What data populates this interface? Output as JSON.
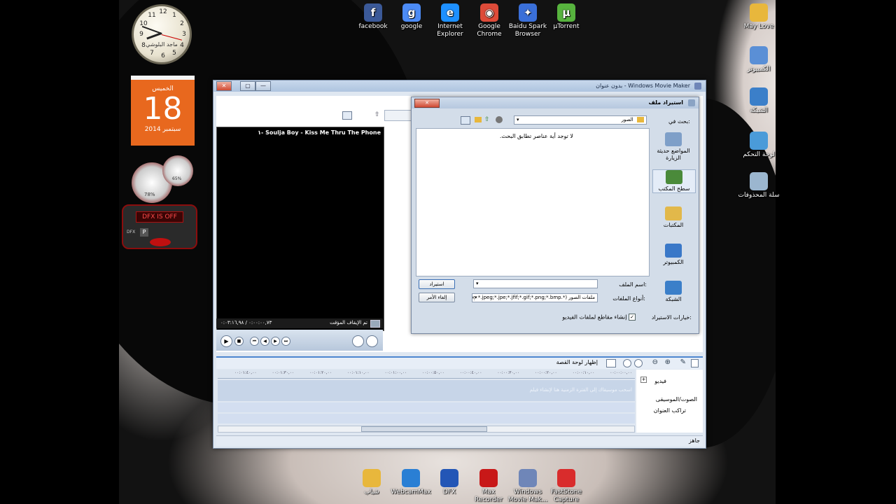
{
  "desktop": {
    "top_icons": [
      {
        "label": "facebook",
        "icon": "facebook-icon",
        "color": "#3b5998",
        "glyph": "f"
      },
      {
        "label": "google",
        "icon": "google-icon",
        "color": "#4c8bf5",
        "glyph": "g"
      },
      {
        "label": "Internet Explorer",
        "icon": "internet-explorer-icon",
        "color": "#1e90ff",
        "glyph": "e"
      },
      {
        "label": "Google Chrome",
        "icon": "chrome-icon",
        "color": "#dd4b39",
        "glyph": "◉"
      },
      {
        "label": "Baidu Spark Browser",
        "icon": "baidu-spark-icon",
        "color": "#3a6fd8",
        "glyph": "✦"
      },
      {
        "label": "µTorrent",
        "icon": "utorrent-icon",
        "color": "#57b33e",
        "glyph": "µ"
      }
    ],
    "right_icons": [
      {
        "label": "May Love ",
        "icon": "folder-icon",
        "color": "#e8b73c"
      },
      {
        "label": "الكمبيوتر",
        "icon": "computer-icon",
        "color": "#5a8fd6"
      },
      {
        "label": "الشبكة",
        "icon": "network-icon",
        "color": "#3b7fc9"
      },
      {
        "label": "لوحة التحكم",
        "icon": "control-panel-icon",
        "color": "#4a9bd9"
      },
      {
        "label": "سلة المحذوفات",
        "icon": "recycle-bin-icon",
        "color": "#9bb6cf"
      }
    ],
    "bottom_icons": [
      {
        "label": "شباب",
        "icon": "folder-icon",
        "color": "#e8b73c"
      },
      {
        "label": "WebcamMax",
        "icon": "webcammax-icon",
        "color": "#2a7fd4"
      },
      {
        "label": "DFX",
        "icon": "dfx-icon",
        "color": "#2356b6"
      },
      {
        "label": "Max Recorder",
        "icon": "max-recorder-icon",
        "color": "#c81818"
      },
      {
        "label": "Windows Movie Mak...",
        "icon": "movie-maker-icon",
        "color": "#6f86b8"
      },
      {
        "label": "FastStone Capture",
        "icon": "faststone-capture-icon",
        "color": "#d92c2c"
      }
    ]
  },
  "gadgets": {
    "clock_name": "ماجد البلوشي",
    "calendar": {
      "weekday": "الخميس",
      "day": "18",
      "month_year": "سبتمبر 2014"
    },
    "cpu_percent": "78%",
    "mem_percent": "65%",
    "dfx": {
      "status": "DFX IS OFF",
      "p_label": "P",
      "dfx_label": "DFX"
    }
  },
  "moviemaker": {
    "title": "بدون عنوان - Windows Movie Maker",
    "track_title": "١- Soulja Boy - Kiss  Me Thru The Phone",
    "player_status": "تم الإيقاف المؤقت",
    "player_time": "٠:٠٠:٠٠,٧٣ / ٠:٠٣:١٦,٩٨",
    "storyboard_toggle": "إظهار لوحة القصة",
    "timeline_hint": "اسحب موسيقاك إلى الفترة الزمنية هنا لإنشاء فيلم",
    "track_video": "فيديو",
    "track_audio": "الصوت/الموسيقى",
    "track_title_overlay": "تراكب العنوان",
    "status": "جاهز",
    "ruler": [
      "٠٠:٠٠:٠٠,٠٠",
      "٠٠:٠٠:١٠,٠٠",
      "٠٠:٠٠:٢٠,٠٠",
      "٠٠:٠٠:٣٠,٠٠",
      "٠٠:٠٠:٤٠,٠٠",
      "٠٠:٠٠:٥٠,٠٠",
      "٠٠:٠١:٠٠,٠٠",
      "٠٠:٠١:١٠,٠٠",
      "٠٠:٠١:٢٠,٠٠",
      "٠٠:٠١:٣٠,٠٠",
      "٠٠:٠١:٤٠,٠٠"
    ]
  },
  "dialog": {
    "title": "استيراد ملف",
    "look_in_label": "بحث في:",
    "look_in_value": "الصور",
    "empty_message": "لا توجد أية عناصر تطابق البحث.",
    "places": [
      "المواضع حديثة الزيارة",
      "سطح المكتب",
      "المكتبات",
      "الكمبيوتر",
      "الشبكة"
    ],
    "filename_label": "اسم الملف:",
    "filename_value": "",
    "filetype_label": "أنواع الملفات:",
    "filetype_value": "ملفات الصور (*.jpg;*.jpeg;*.jpe;*.jfif;*.gif;*.png;*.bmp)",
    "import_button": "استيراد",
    "cancel_button": "إلغاء الأمر",
    "options_label": "خيارات الاستيراد:",
    "create_clips_label": "إنشاء مقاطع لملفات الفيديو",
    "create_clips_checked": true
  }
}
